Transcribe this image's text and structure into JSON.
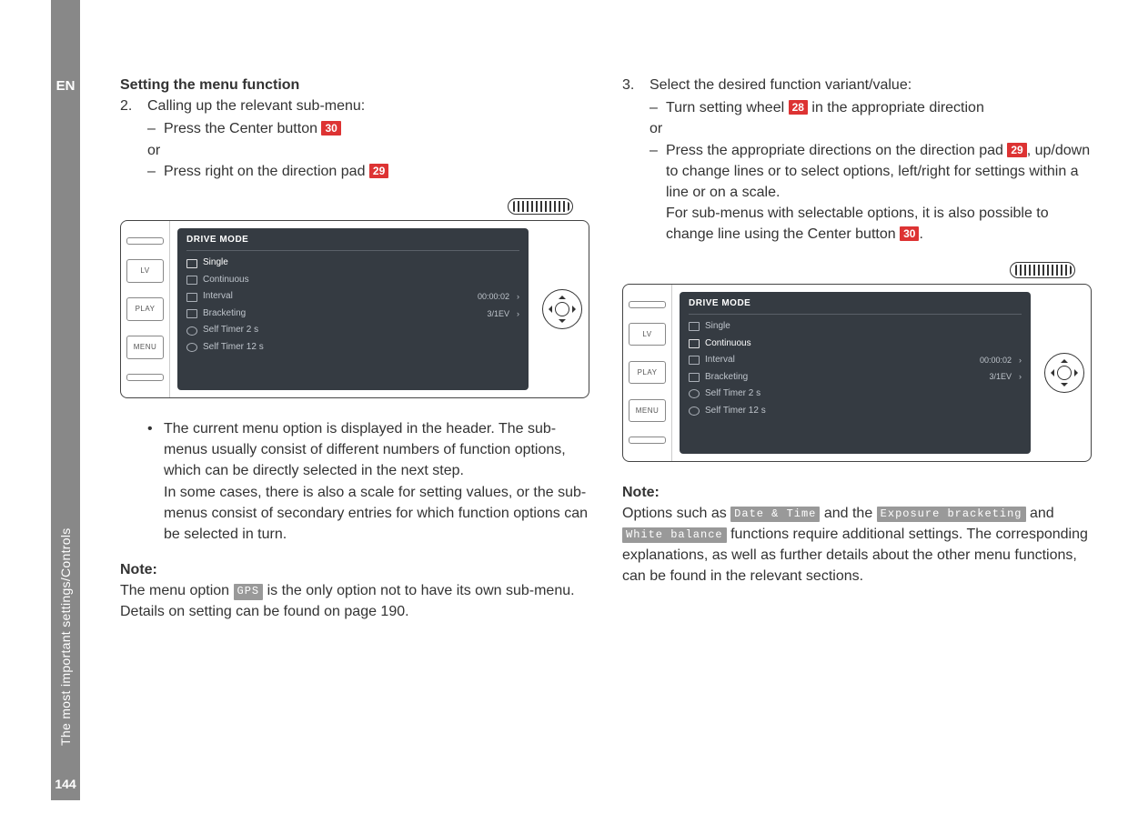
{
  "sidebar": {
    "lang": "EN",
    "section": "The most important settings/Controls",
    "page_number": "144"
  },
  "left": {
    "heading": "Setting the menu function",
    "step2_num": "2.",
    "step2_text": "Calling up the relevant sub-menu:",
    "step2_a": "Press the Center button ",
    "step2_a_ref": "30",
    "or": "or",
    "step2_b": "Press right on the direction pad ",
    "step2_b_ref": "29",
    "bullet": "The current menu option is displayed in the header. The sub-menus usually consist of different numbers of function options, which can be directly selected in the next step.",
    "bullet2": "In some cases, there is also a scale for setting values, or the sub-menus consist of secondary entries for which function options can be selected in turn.",
    "note_label": "Note:",
    "note_a": "The menu option ",
    "note_opt": "GPS",
    "note_b": " is the only option not to have its own sub-menu. Details on setting can be found on page 190."
  },
  "right": {
    "step3_num": "3.",
    "step3_text": "Select the desired function variant/value:",
    "step3_a": "Turn setting wheel ",
    "step3_a_ref": "28",
    "step3_a_tail": " in the appropriate direction",
    "or": "or",
    "step3_b": "Press the appropriate directions on the direction pad ",
    "step3_b_ref": "29",
    "step3_b_tail": ", up/down to change lines or to select options, left/right for settings within a line or on a scale.",
    "step3_b2": "For sub-menus with selectable options, it is also possible to change line using the Center button ",
    "step3_b2_ref": "30",
    "step3_b2_tail": ".",
    "note_label": "Note:",
    "note_a": "Options such as ",
    "note_opt1": "Date & Time",
    "note_b": " and the ",
    "note_opt2": "Exposure bracketing",
    "note_c": " and ",
    "note_opt3": "White balance",
    "note_d": " functions require additional settings. The corresponding explanations, as well as further details about the other menu functions, can be found in the relevant sections."
  },
  "device": {
    "buttons": {
      "blank": "",
      "lv": "LV",
      "play": "PLAY",
      "menu": "MENU"
    },
    "screen_title": "DRIVE MODE",
    "rows": [
      {
        "label": "Single",
        "value": "",
        "sel_left": true,
        "sel_right": false
      },
      {
        "label": "Continuous",
        "value": "",
        "sel_left": false,
        "sel_right": true
      },
      {
        "label": "Interval",
        "value": "00:00:02",
        "sel_left": false,
        "sel_right": false,
        "chev": true
      },
      {
        "label": "Bracketing",
        "value": "3/1EV",
        "sel_left": false,
        "sel_right": false,
        "chev": true
      },
      {
        "label": "Self Timer 2 s",
        "value": "",
        "sel_left": false,
        "sel_right": false,
        "timer": true
      },
      {
        "label": "Self Timer 12 s",
        "value": "",
        "sel_left": false,
        "sel_right": false,
        "timer": true
      }
    ]
  }
}
